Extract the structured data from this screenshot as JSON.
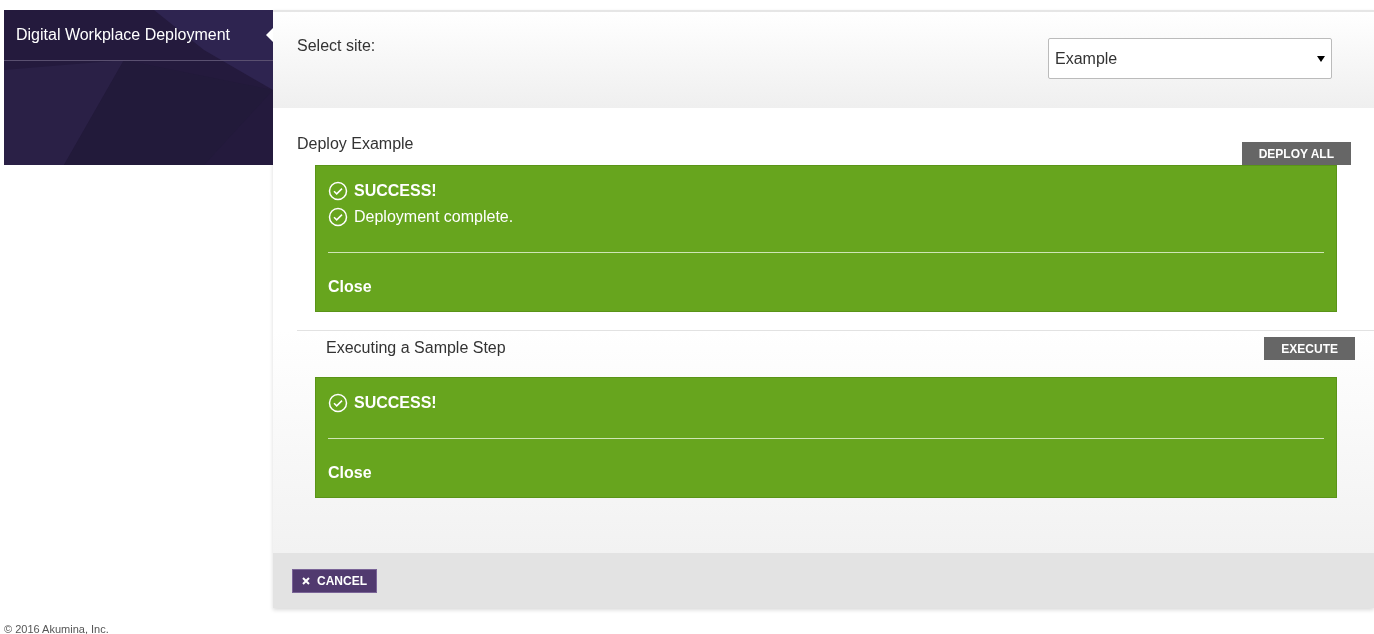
{
  "sidebar": {
    "title": "Digital Workplace Deployment"
  },
  "site_selector": {
    "label": "Select site:",
    "value": "Example"
  },
  "steps": [
    {
      "title": "Deploy Example",
      "button": "DEPLOY ALL",
      "divider": false,
      "alert": {
        "messages": [
          {
            "text": "SUCCESS!",
            "strong": true
          },
          {
            "text": "Deployment complete.",
            "strong": false
          }
        ],
        "close": "Close"
      }
    },
    {
      "title": "Executing a Sample Step",
      "button": "EXECUTE",
      "divider": true,
      "alert": {
        "messages": [
          {
            "text": "SUCCESS!",
            "strong": true
          }
        ],
        "close": "Close"
      }
    }
  ],
  "cancel_button": "CANCEL",
  "footer": "© 2016 Akumina, Inc."
}
